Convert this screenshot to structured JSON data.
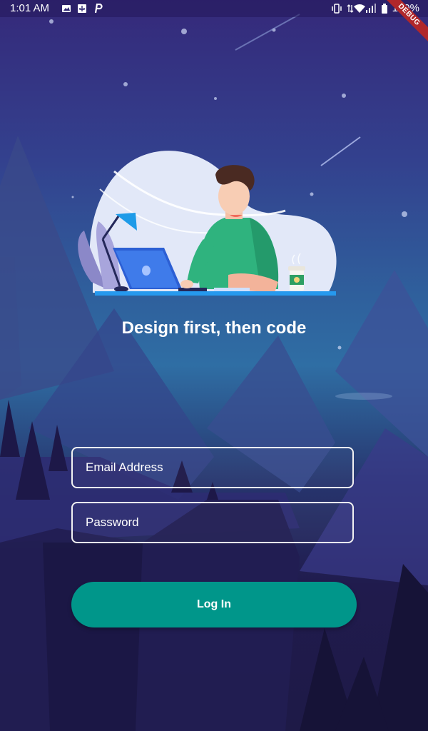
{
  "status_bar": {
    "time": "1:01 AM",
    "battery": "100%",
    "debug_label": "DEBUG"
  },
  "tagline": "Design first, then code",
  "form": {
    "email_placeholder": "Email Address",
    "email_value": "",
    "password_placeholder": "Password",
    "password_value": "",
    "login_label": "Log In"
  },
  "colors": {
    "accent": "#00968a",
    "sky_top": "#35297a",
    "sky_mid": "#2f6ea4",
    "ground": "#1e1a47"
  },
  "icons": [
    "image-icon",
    "usb-icon",
    "parking-icon",
    "vibrate-icon",
    "data-arrows-icon",
    "wifi-icon",
    "signal-icon",
    "battery-icon"
  ]
}
